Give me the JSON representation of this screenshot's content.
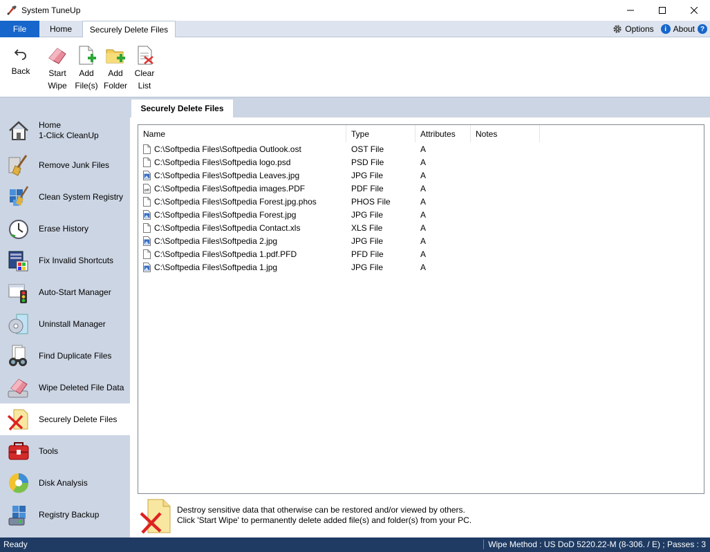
{
  "window": {
    "title": "System TuneUp"
  },
  "ribbon": {
    "file_label": "File",
    "tabs": [
      {
        "label": "Home"
      },
      {
        "label": "Securely Delete Files"
      }
    ],
    "options_label": "Options",
    "about_label": "About"
  },
  "toolbar": {
    "buttons": [
      {
        "label": "Back",
        "icon": "back-arrow-icon"
      },
      {
        "label": "Start Wipe",
        "icon": "eraser-icon"
      },
      {
        "label": "Add File(s)",
        "icon": "add-file-icon"
      },
      {
        "label": "Add Folder",
        "icon": "add-folder-icon"
      },
      {
        "label": "Clear List",
        "icon": "clear-list-icon"
      }
    ]
  },
  "sidebar": {
    "items": [
      {
        "label_line1": "Home",
        "label_line2": "1-Click CleanUp",
        "icon": "home-icon"
      },
      {
        "label": "Remove Junk Files",
        "icon": "broom-icon"
      },
      {
        "label": "Clean System Registry",
        "icon": "registry-icon"
      },
      {
        "label": "Erase History",
        "icon": "clock-icon"
      },
      {
        "label": "Fix Invalid Shortcuts",
        "icon": "shortcut-icon"
      },
      {
        "label": "Auto-Start Manager",
        "icon": "traffic-light-icon"
      },
      {
        "label": "Uninstall Manager",
        "icon": "disc-icon"
      },
      {
        "label": "Find Duplicate Files",
        "icon": "binoculars-icon"
      },
      {
        "label": "Wipe Deleted File Data",
        "icon": "eraser-icon"
      },
      {
        "label": "Securely Delete Files",
        "icon": "delete-file-icon"
      },
      {
        "label": "Tools",
        "icon": "toolbox-icon"
      },
      {
        "label": "Disk Analysis",
        "icon": "pie-disk-icon"
      },
      {
        "label": "Registry Backup",
        "icon": "registry-backup-icon"
      }
    ],
    "active_index": 9
  },
  "content_tab": {
    "label": "Securely Delete Files"
  },
  "list": {
    "columns": [
      "Name",
      "Type",
      "Attributes",
      "Notes"
    ],
    "rows": [
      {
        "name": "C:\\Softpedia Files\\Softpedia Outlook.ost",
        "type": "OST File",
        "attributes": "A",
        "notes": "",
        "icon": "generic-file-icon"
      },
      {
        "name": "C:\\Softpedia Files\\Softpedia logo.psd",
        "type": "PSD File",
        "attributes": "A",
        "notes": "",
        "icon": "generic-file-icon"
      },
      {
        "name": "C:\\Softpedia Files\\Softpedia Leaves.jpg",
        "type": "JPG File",
        "attributes": "A",
        "notes": "",
        "icon": "image-file-icon"
      },
      {
        "name": "C:\\Softpedia Files\\Softpedia images.PDF",
        "type": "PDF File",
        "attributes": "A",
        "notes": "",
        "icon": "pdf-file-icon"
      },
      {
        "name": "C:\\Softpedia Files\\Softpedia Forest.jpg.phos",
        "type": "PHOS File",
        "attributes": "A",
        "notes": "",
        "icon": "generic-file-icon"
      },
      {
        "name": "C:\\Softpedia Files\\Softpedia Forest.jpg",
        "type": "JPG File",
        "attributes": "A",
        "notes": "",
        "icon": "image-file-icon"
      },
      {
        "name": "C:\\Softpedia Files\\Softpedia Contact.xls",
        "type": "XLS File",
        "attributes": "A",
        "notes": "",
        "icon": "generic-file-icon"
      },
      {
        "name": "C:\\Softpedia Files\\Softpedia 2.jpg",
        "type": "JPG File",
        "attributes": "A",
        "notes": "",
        "icon": "image-file-icon"
      },
      {
        "name": "C:\\Softpedia Files\\Softpedia 1.pdf.PFD",
        "type": "PFD File",
        "attributes": "A",
        "notes": "",
        "icon": "generic-file-icon"
      },
      {
        "name": "C:\\Softpedia Files\\Softpedia 1.jpg",
        "type": "JPG File",
        "attributes": "A",
        "notes": "",
        "icon": "image-file-icon"
      }
    ]
  },
  "info": {
    "line1": "Destroy sensitive data that otherwise can be restored and/or viewed by others.",
    "line2": "Click 'Start Wipe' to permanently delete added file(s) and folder(s) from your PC."
  },
  "status": {
    "left": "Ready",
    "right": "Wipe Method : US DoD 5220.22-M (8-306. / E) ; Passes : 3"
  },
  "colors": {
    "accent": "#1766cc",
    "sidebar_bg": "#ccd5e3",
    "status_bg": "#1f3b63"
  }
}
